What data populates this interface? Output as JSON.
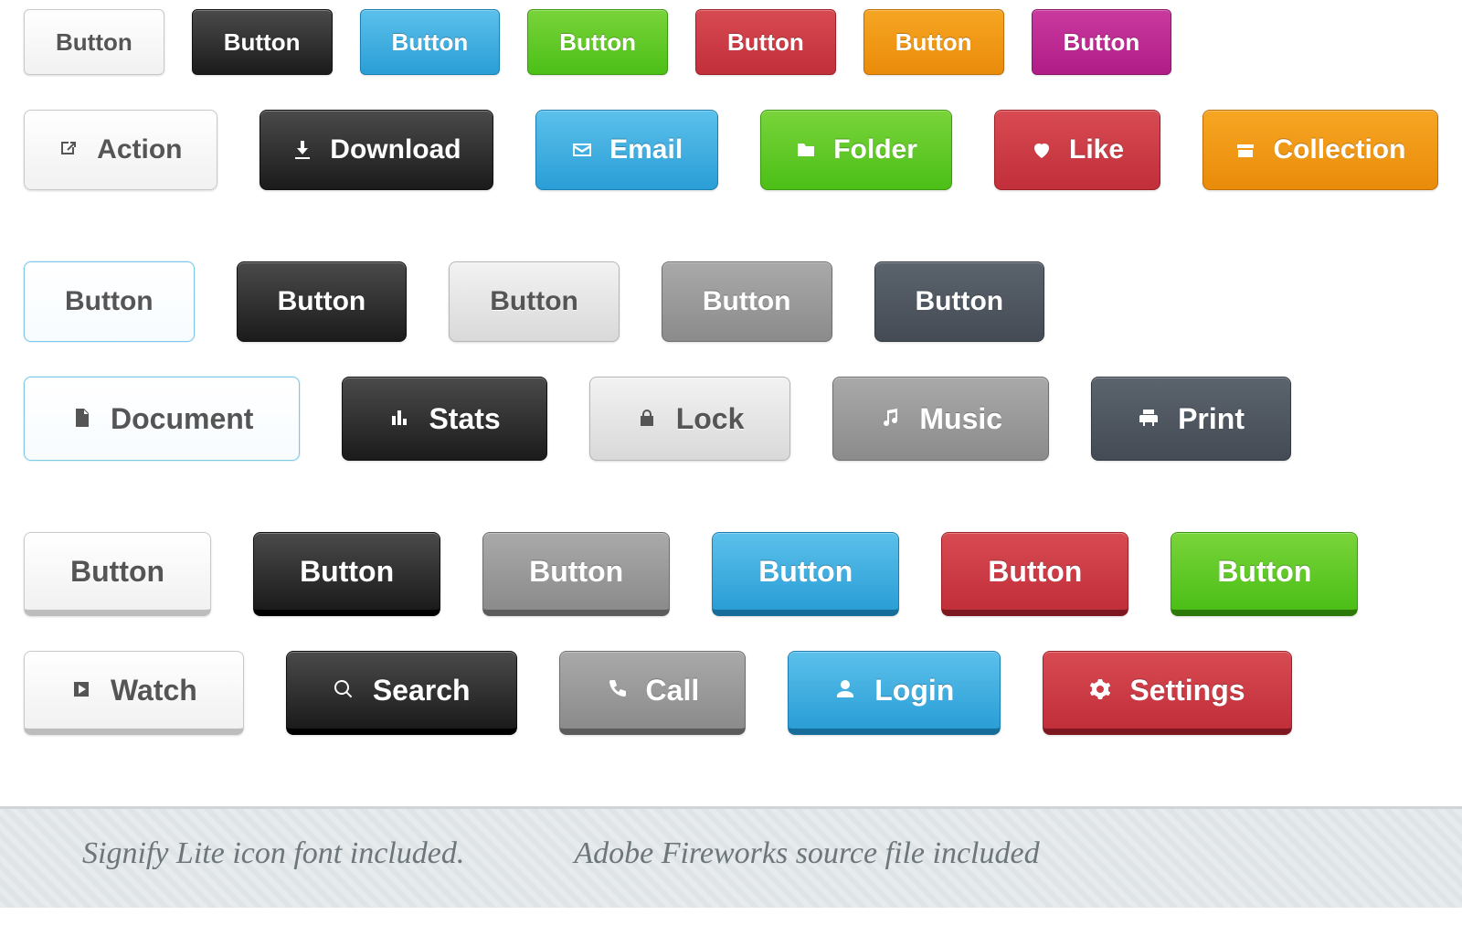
{
  "row1": [
    {
      "label": "Button",
      "color": "white"
    },
    {
      "label": "Button",
      "color": "black"
    },
    {
      "label": "Button",
      "color": "blue"
    },
    {
      "label": "Button",
      "color": "green"
    },
    {
      "label": "Button",
      "color": "red"
    },
    {
      "label": "Button",
      "color": "orange"
    },
    {
      "label": "Button",
      "color": "magenta"
    }
  ],
  "row2": [
    {
      "label": "Action",
      "color": "white",
      "icon": "external"
    },
    {
      "label": "Download",
      "color": "black",
      "icon": "download"
    },
    {
      "label": "Email",
      "color": "blue",
      "icon": "mail"
    },
    {
      "label": "Folder",
      "color": "green",
      "icon": "folder"
    },
    {
      "label": "Like",
      "color": "red",
      "icon": "heart"
    },
    {
      "label": "Collection",
      "color": "orange",
      "icon": "box"
    }
  ],
  "row3": [
    {
      "label": "Button",
      "color": "outline"
    },
    {
      "label": "Button",
      "color": "black"
    },
    {
      "label": "Button",
      "color": "lgray"
    },
    {
      "label": "Button",
      "color": "mgray"
    },
    {
      "label": "Button",
      "color": "slate"
    }
  ],
  "row4": [
    {
      "label": "Document",
      "color": "outline",
      "icon": "doc"
    },
    {
      "label": "Stats",
      "color": "black",
      "icon": "stats"
    },
    {
      "label": "Lock",
      "color": "lgray",
      "icon": "lock"
    },
    {
      "label": "Music",
      "color": "mgray",
      "icon": "music"
    },
    {
      "label": "Print",
      "color": "slate",
      "icon": "print"
    }
  ],
  "row5": [
    {
      "label": "Button",
      "color": "white",
      "edge": "r-white"
    },
    {
      "label": "Button",
      "color": "black",
      "edge": "r-black"
    },
    {
      "label": "Button",
      "color": "mgray",
      "edge": "r-mgray"
    },
    {
      "label": "Button",
      "color": "blue",
      "edge": "r-blue"
    },
    {
      "label": "Button",
      "color": "red",
      "edge": "r-red"
    },
    {
      "label": "Button",
      "color": "green",
      "edge": "r-green"
    }
  ],
  "row6": [
    {
      "label": "Watch",
      "color": "white",
      "edge": "r-white",
      "icon": "play"
    },
    {
      "label": "Search",
      "color": "black",
      "edge": "r-black",
      "icon": "search"
    },
    {
      "label": "Call",
      "color": "mgray",
      "edge": "r-mgray",
      "icon": "phone"
    },
    {
      "label": "Login",
      "color": "blue",
      "edge": "r-blue",
      "icon": "user"
    },
    {
      "label": "Settings",
      "color": "red",
      "edge": "r-red",
      "icon": "gear"
    }
  ],
  "footer": {
    "left": "Signify Lite icon font included.",
    "right": "Adobe Fireworks source file included"
  }
}
